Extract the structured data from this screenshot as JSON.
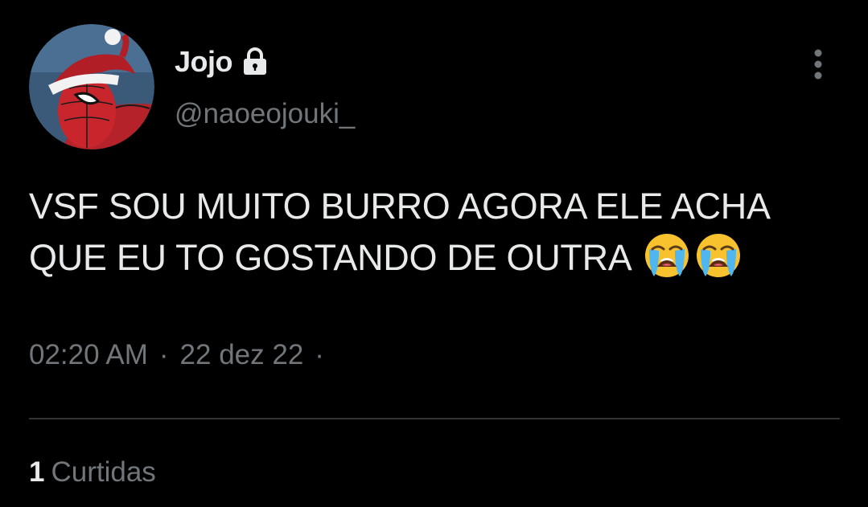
{
  "tweet": {
    "author": {
      "display_name": "Jojo",
      "handle": "@naoeojouki_",
      "avatar_description": "spider-man-santa-hat-avatar",
      "protected": true
    },
    "text_lines": [
      "VSF SOU MUITO BURRO AGORA ELE ACHA",
      "QUE EU TO GOSTANDO DE OUTRA"
    ],
    "emojis": [
      "loudly-crying-face",
      "loudly-crying-face"
    ],
    "time": "02:20 AM",
    "separator": "·",
    "date": "22 dez 22",
    "likes": {
      "count": "1",
      "label": "Curtidas"
    }
  },
  "colors": {
    "background": "#000000",
    "primary_text": "#e7e9ea",
    "secondary_text": "#71767b",
    "divider": "#2f3336"
  },
  "icons": {
    "lock": "lock-icon",
    "more": "more-vertical-icon"
  }
}
